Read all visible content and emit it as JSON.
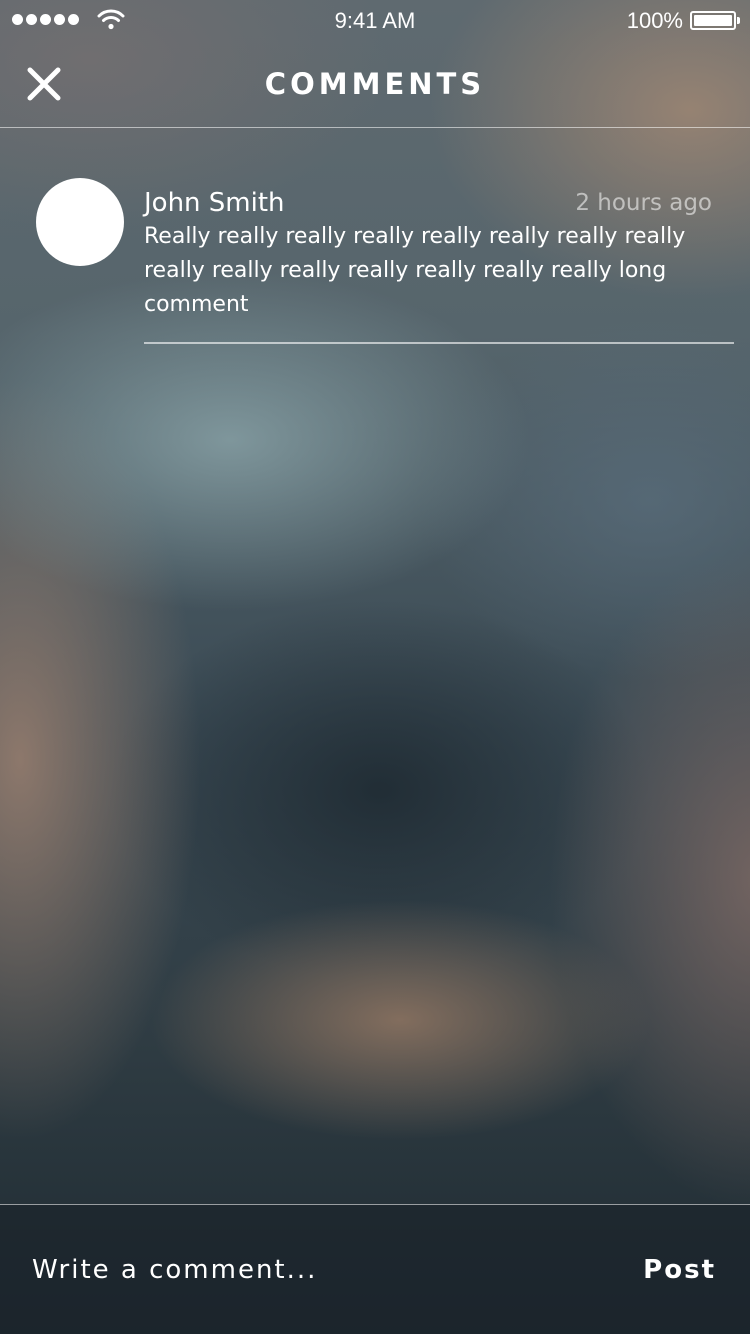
{
  "status_bar": {
    "signal_icon": "signal-dots-icon",
    "wifi_icon": "wifi-icon",
    "time": "9:41 AM",
    "battery_percent": "100%",
    "battery_icon": "battery-icon"
  },
  "header": {
    "close_icon": "close-icon",
    "title": "COMMENTS"
  },
  "comments": [
    {
      "author": "John Smith",
      "time_ago": "2 hours ago",
      "text": "Really really really really really really really really really really really really really really really long comment"
    }
  ],
  "composer": {
    "placeholder": "Write a comment...",
    "value": "",
    "post_label": "Post"
  },
  "colors": {
    "text": "#ffffff",
    "muted": "rgba(255,255,255,0.55)",
    "avatar": "#ffffff"
  }
}
